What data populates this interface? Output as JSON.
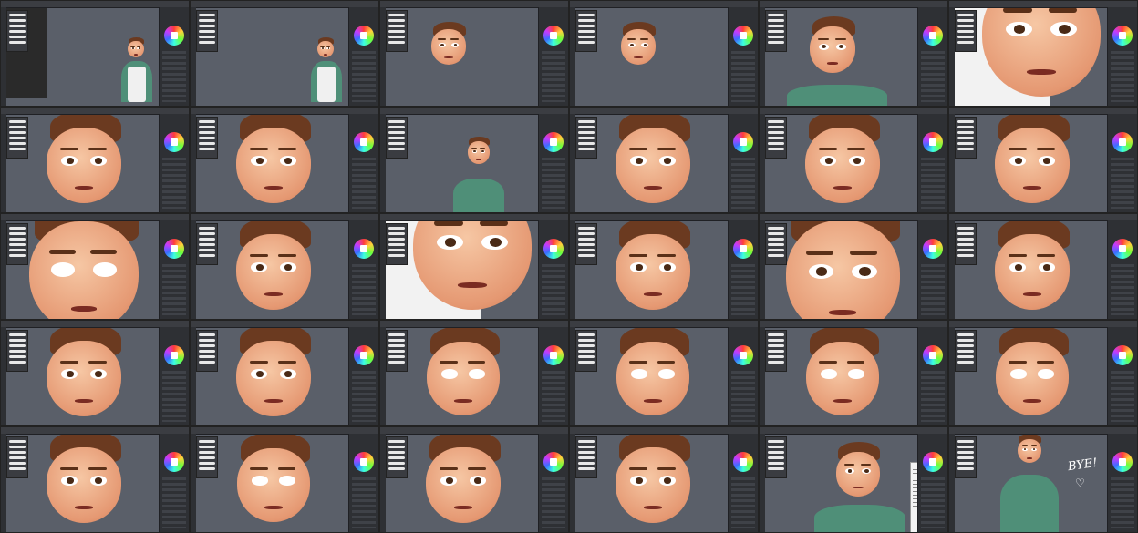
{
  "sheet": {
    "columns": 6,
    "rows": 5,
    "background": "#000000",
    "canvas_color": "#5a5f69",
    "panel_color": "#2e3034"
  },
  "frames": [
    {
      "id": 1,
      "scene": "full-body-apron"
    },
    {
      "id": 2,
      "scene": "full-body-apron"
    },
    {
      "id": 3,
      "scene": "floating-face"
    },
    {
      "id": 4,
      "scene": "floating-face"
    },
    {
      "id": 5,
      "scene": "chest-up-smile"
    },
    {
      "id": 6,
      "scene": "extreme-closeup-chin"
    },
    {
      "id": 7,
      "scene": "face-closeup-looking-right"
    },
    {
      "id": 8,
      "scene": "face-closeup-talking"
    },
    {
      "id": 9,
      "scene": "small-bust"
    },
    {
      "id": 10,
      "scene": "face-closeup-talking"
    },
    {
      "id": 11,
      "scene": "face-closeup-looking-left"
    },
    {
      "id": 12,
      "scene": "face-closeup-talking"
    },
    {
      "id": 13,
      "scene": "extreme-closeup-blank-eyes"
    },
    {
      "id": 14,
      "scene": "face-closeup-talking"
    },
    {
      "id": 15,
      "scene": "extreme-closeup-chin"
    },
    {
      "id": 16,
      "scene": "face-closeup-talking"
    },
    {
      "id": 17,
      "scene": "extreme-closeup-eyes"
    },
    {
      "id": 18,
      "scene": "face-closeup-smirk"
    },
    {
      "id": 19,
      "scene": "face-closeup-looking-left"
    },
    {
      "id": 20,
      "scene": "face-closeup-talking"
    },
    {
      "id": 21,
      "scene": "face-closeup-blank-eyes"
    },
    {
      "id": 22,
      "scene": "face-closeup-blank-eyes"
    },
    {
      "id": 23,
      "scene": "face-closeup-blank-eyes"
    },
    {
      "id": 24,
      "scene": "face-closeup-blank-eyes"
    },
    {
      "id": 25,
      "scene": "face-closeup-looking-right"
    },
    {
      "id": 26,
      "scene": "face-closeup-blank-eyes"
    },
    {
      "id": 27,
      "scene": "face-closeup-brows"
    },
    {
      "id": 28,
      "scene": "face-closeup-talking"
    },
    {
      "id": 29,
      "scene": "bust-with-menu"
    },
    {
      "id": 30,
      "scene": "bust-bye"
    }
  ],
  "farewell_text": "BYE!",
  "icons": {
    "brush_panel": "brush-presets-icon",
    "color_wheel": "color-wheel-icon",
    "layers": "layers-panel-icon"
  }
}
